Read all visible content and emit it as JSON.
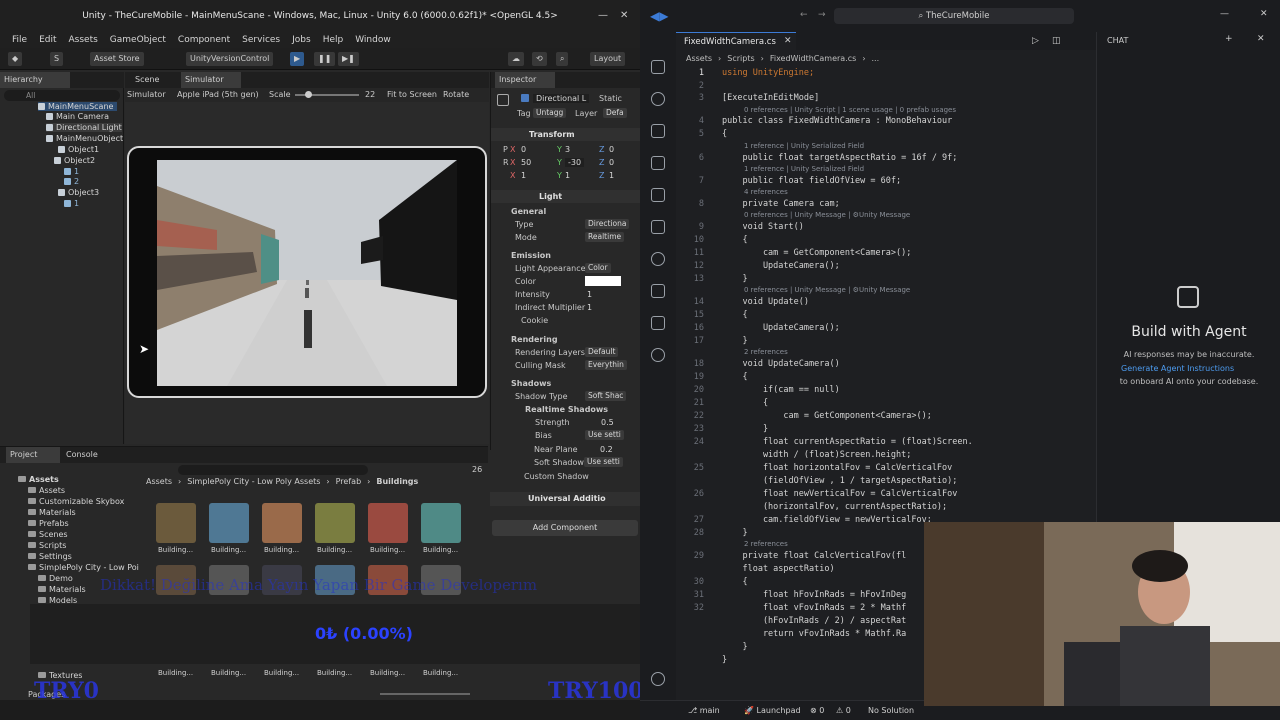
{
  "unity": {
    "title": "Unity - TheCureMobile - MainMenuScane - Windows, Mac, Linux - Unity 6.0 (6000.0.62f1)* <OpenGL 4.5>",
    "menu": [
      "File",
      "Edit",
      "Assets",
      "GameObject",
      "Component",
      "Services",
      "Jobs",
      "Help",
      "Window"
    ],
    "toolbar": {
      "account": "S",
      "asset_store": "Asset Store",
      "version_control": "UnityVersionControl",
      "layout": "Layout"
    },
    "hierarchy": {
      "tab": "Hierarchy",
      "search_placeholder": "All",
      "items": [
        "MainMenuScane",
        "Main Camera",
        "Directional Light",
        "MainMenuObject",
        "Object1",
        "Object2",
        "1",
        "2",
        "Object3",
        "1"
      ]
    },
    "scene": {
      "tabs": [
        "Scene",
        "Simulator"
      ],
      "mode": "Simulator",
      "device": "Apple iPad (5th gen)",
      "scale_label": "Scale",
      "scale_value": "22",
      "fit": "Fit to Screen",
      "rotate": "Rotate"
    },
    "inspector": {
      "tab": "Inspector",
      "object_name": "Directional L",
      "static_label": "Static",
      "tag_label": "Tag",
      "tag_value": "Untagg",
      "layer_label": "Layer",
      "layer_value": "Defa",
      "transform": {
        "title": "Transform",
        "axis_x": "X",
        "axis_y": "Y",
        "axis_z": "Z",
        "position": [
          "0",
          "3",
          "0"
        ],
        "rotation": [
          "50",
          "-30",
          "0"
        ],
        "scale": [
          "1",
          "1",
          "1"
        ],
        "pos_label": "P",
        "rot_label": "R"
      },
      "light": {
        "title": "Light",
        "general": "General",
        "type_label": "Type",
        "type_value": "Directiona",
        "mode_label": "Mode",
        "mode_value": "Realtime",
        "emission": "Emission",
        "appearance_label": "Light Appearance",
        "appearance_value": "Color",
        "color_label": "Color",
        "intensity_label": "Intensity",
        "intensity_value": "1",
        "indirect_label": "Indirect Multiplier",
        "indirect_value": "1",
        "cookie_label": "Cookie",
        "rendering": "Rendering",
        "render_layers_label": "Rendering Layers",
        "render_layers_value": "Default",
        "culling_label": "Culling Mask",
        "culling_value": "Everythin",
        "shadows": "Shadows",
        "shadow_type_label": "Shadow Type",
        "shadow_type_value": "Soft Shac",
        "realtime_shadows": "Realtime Shadows",
        "strength_label": "Strength",
        "strength_value": "0.5",
        "bias_label": "Bias",
        "bias_value": "Use setti",
        "near_label": "Near Plane",
        "near_value": "0.2",
        "soft_label": "Soft Shadow",
        "soft_value": "Use setti",
        "custom_label": "Custom Shadow"
      },
      "universal": "Universal Additio",
      "add_component": "Add Component"
    },
    "project": {
      "tabs": [
        "Project",
        "Console"
      ],
      "count": "26",
      "breadcrumb": [
        "Assets",
        "SimplePoly City - Low Poly Assets",
        "Prefab",
        "Buildings"
      ],
      "tree": [
        "Assets",
        "Assets",
        "Customizable Skybox",
        "Materials",
        "Prefabs",
        "Scenes",
        "Scripts",
        "Settings",
        "SimplePoly City - Low Poi",
        "Demo",
        "Materials",
        "Models",
        "Textures"
      ],
      "asset_label": "Building..."
    },
    "overlay": {
      "marquee": "Dikkat! Değiline Ama Yayın Yapan Bir Game Developerım",
      "progress": "0₺ (0.00%)",
      "left_tag": "TRY0",
      "right_tag": "TRY10000",
      "packages": "Packages"
    },
    "colors": {
      "accent": "#3c7bd6",
      "panel": "#282828",
      "toolbar": "#1f1f1f",
      "overlay_text": "#2b42ff"
    }
  },
  "vscode": {
    "search": "TheCureMobile",
    "tab": "FixedWidthCamera.cs",
    "breadcrumb": [
      "Assets",
      "Scripts",
      "FixedWidthCamera.cs",
      "..."
    ],
    "code": [
      {
        "n": "1",
        "text": "using UnityEngine;"
      },
      {
        "n": "2",
        "text": ""
      },
      {
        "n": "3",
        "text": "[ExecuteInEditMode]"
      },
      {
        "n": "4",
        "text": "public class FixedWidthCamera : MonoBehaviour"
      },
      {
        "n": "5",
        "text": "{"
      },
      {
        "n": "6",
        "text": "    public float targetAspectRatio = 16f / 9f;"
      },
      {
        "n": "7",
        "text": "    public float fieldOfView = 60f;"
      },
      {
        "n": "8",
        "text": "    private Camera cam;"
      },
      {
        "n": "9",
        "text": "    void Start()"
      },
      {
        "n": "10",
        "text": "    {"
      },
      {
        "n": "11",
        "text": "        cam = GetComponent<Camera>();"
      },
      {
        "n": "12",
        "text": "        UpdateCamera();"
      },
      {
        "n": "13",
        "text": "    }"
      },
      {
        "n": "14",
        "text": "    void Update()"
      },
      {
        "n": "15",
        "text": "    {"
      },
      {
        "n": "16",
        "text": "        UpdateCamera();"
      },
      {
        "n": "17",
        "text": "    }"
      },
      {
        "n": "18",
        "text": "    void UpdateCamera()"
      },
      {
        "n": "19",
        "text": "    {"
      },
      {
        "n": "20",
        "text": "        if(cam == null)"
      },
      {
        "n": "21",
        "text": "        {"
      },
      {
        "n": "22",
        "text": "            cam = GetComponent<Camera>();"
      },
      {
        "n": "23",
        "text": "        }"
      },
      {
        "n": "24",
        "text": "        float currentAspectRatio = (float)Screen."
      },
      {
        "n": "",
        "text": "        width / (float)Screen.height;"
      },
      {
        "n": "25",
        "text": "        float horizontalFov = CalcVerticalFov"
      },
      {
        "n": "",
        "text": "        (fieldOfView , 1 / targetAspectRatio);"
      },
      {
        "n": "26",
        "text": "        float newVerticalFov = CalcVerticalFov"
      },
      {
        "n": "",
        "text": "        (horizontalFov, currentAspectRatio);"
      },
      {
        "n": "27",
        "text": "        cam.fieldOfView = newVerticalFov;"
      },
      {
        "n": "28",
        "text": "    }"
      },
      {
        "n": "29",
        "text": "    private float CalcVerticalFov(fl"
      },
      {
        "n": "",
        "text": "    float aspectRatio)"
      },
      {
        "n": "30",
        "text": "    {"
      },
      {
        "n": "31",
        "text": "        float hFovInRads = hFovInDeg"
      },
      {
        "n": "32",
        "text": "        float vFovInRads = 2 * Mathf"
      },
      {
        "n": "",
        "text": "        (hFovInRads / 2) / aspectRat"
      },
      {
        "n": "",
        "text": "        return vFovInRads * Mathf.Ra"
      },
      {
        "n": "",
        "text": "    }"
      },
      {
        "n": "",
        "text": "}"
      }
    ],
    "refs": {
      "r4": "0 references | Unity Script | 1 scene usage | 0 prefab usages",
      "r6": "1 reference | Unity Serialized Field",
      "r7": "1 reference | Unity Serialized Field",
      "r8": "4 references",
      "r9": "0 references | Unity Message | ⚙Unity Message",
      "r14": "0 references | Unity Message | ⚙Unity Message",
      "r18": "2 references",
      "r29": "2 references"
    },
    "chat": {
      "title": "CHAT",
      "heading": "Build with Agent",
      "notice": "AI responses may be inaccurate.",
      "link": "Generate Agent Instructions",
      "tail": "to onboard AI onto your codebase."
    },
    "status": {
      "branch": "main",
      "launchpad": "Launchpad",
      "errors": "0",
      "warnings": "0",
      "solution": "No Solution"
    }
  }
}
